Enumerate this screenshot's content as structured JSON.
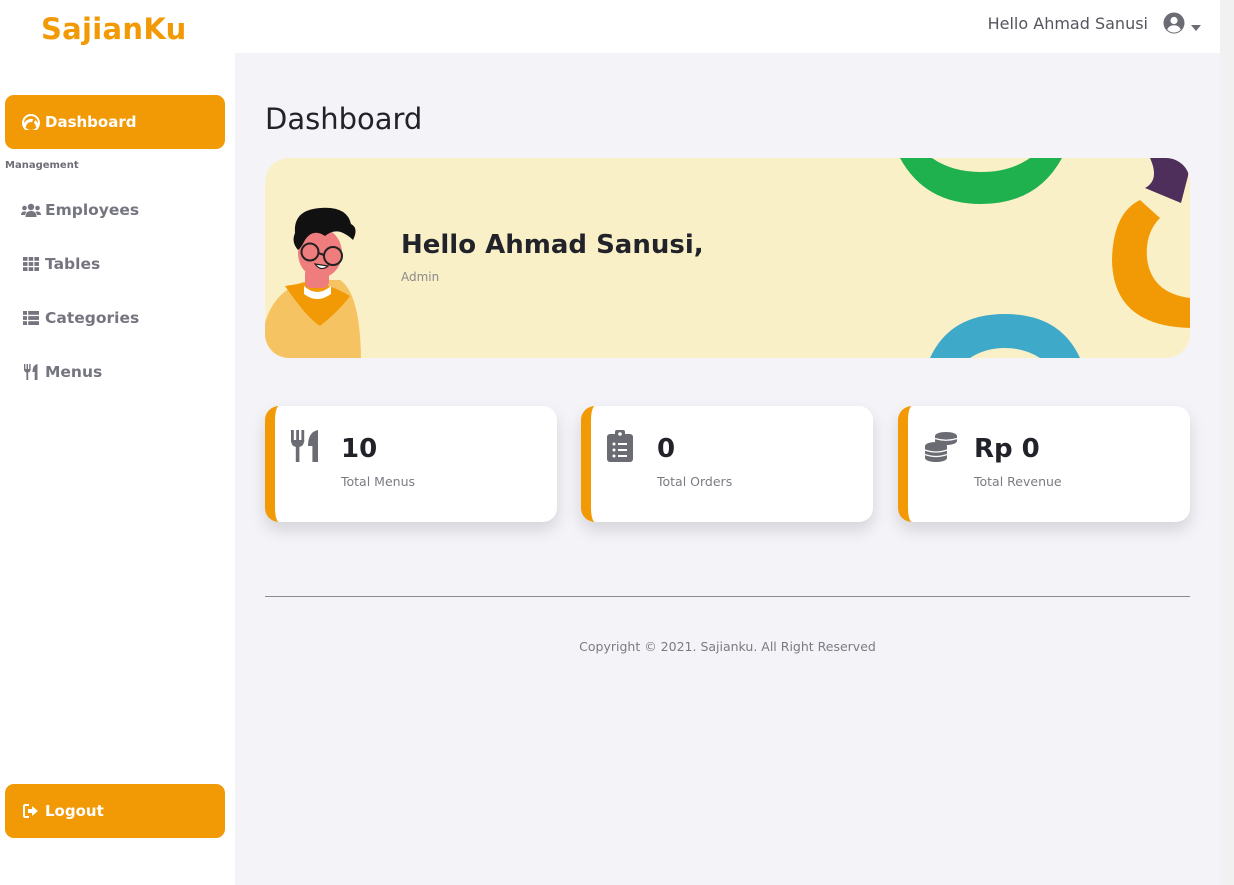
{
  "brand": "SajianKu",
  "topbar": {
    "greeting": "Hello Ahmad Sanusi",
    "user_icon": "user-circle-icon",
    "caret_icon": "caret-down-icon"
  },
  "sidebar": {
    "active": {
      "label": "Dashboard",
      "icon": "tachometer-icon"
    },
    "section_label": "Management",
    "items": [
      {
        "label": "Employees",
        "icon": "users-icon"
      },
      {
        "label": "Tables",
        "icon": "grid-icon"
      },
      {
        "label": "Categories",
        "icon": "list-icon"
      },
      {
        "label": "Menus",
        "icon": "utensils-icon"
      }
    ],
    "logout": {
      "label": "Logout",
      "icon": "sign-out-icon"
    }
  },
  "main": {
    "title": "Dashboard",
    "banner": {
      "hello": "Hello Ahmad Sanusi,",
      "role": "Admin"
    },
    "cards": [
      {
        "value": "10",
        "label": "Total Menus",
        "icon": "utensils-icon"
      },
      {
        "value": "0",
        "label": "Total Orders",
        "icon": "clipboard-list-icon"
      },
      {
        "value": "Rp 0",
        "label": "Total Revenue",
        "icon": "coins-icon"
      }
    ]
  },
  "footer": {
    "copyright": "Copyright © 2021. Sajianku. All Right Reserved"
  },
  "colors": {
    "accent": "#f29a06",
    "banner_bg": "#faf0c8",
    "page_bg": "#f4f3f8"
  }
}
